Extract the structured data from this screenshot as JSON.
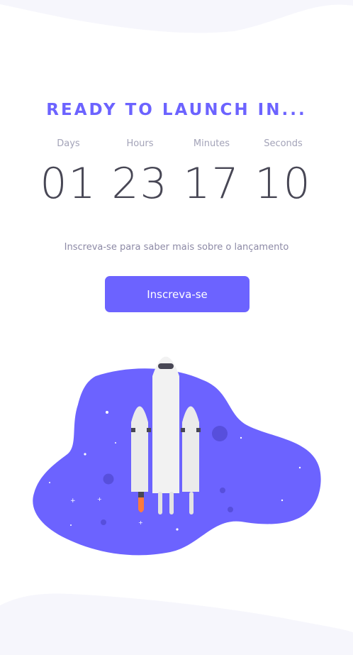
{
  "countdown": {
    "title": "READY TO LAUNCH IN...",
    "units": [
      {
        "label": "Days",
        "value": "01"
      },
      {
        "label": "Hours",
        "value": "23"
      },
      {
        "label": "Minutes",
        "value": "17"
      },
      {
        "label": "Seconds",
        "value": "10"
      }
    ]
  },
  "subscribe": {
    "text": "Inscreva-se para saber mais sobre o lançamento",
    "button_label": "Inscreva-se"
  },
  "illustration": {
    "icon": "rocket-icon",
    "blob_color": "#6c63ff"
  },
  "colors": {
    "accent": "#6c63ff",
    "digits": "#484755",
    "muted": "#a3a3b8"
  }
}
